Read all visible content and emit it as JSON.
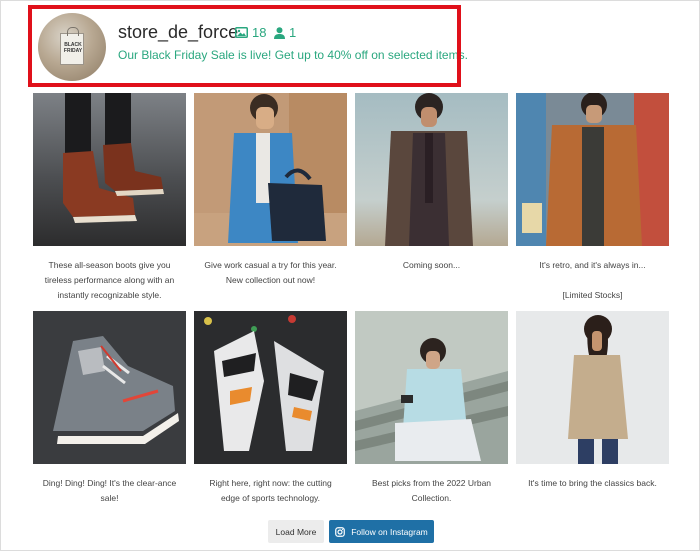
{
  "header": {
    "username": "store_de_force",
    "posts_count": "18",
    "followers_count": "1",
    "bio": "Our Black Friday Sale is live! Get up to 40% off on selected items.",
    "avatar_text": "BLACK FRIDAY"
  },
  "posts": [
    {
      "caption": "These all-season boots give you tireless performance along with an instantly recognizable style."
    },
    {
      "caption": "Give work casual a try for this year. New collection out now!"
    },
    {
      "caption": "Coming soon..."
    },
    {
      "caption": "It's retro, and it's always in...\n\n[Limited Stocks]"
    },
    {
      "caption": "Ding! Ding! Ding! It's the clear-ance sale!"
    },
    {
      "caption": "Right here, right now: the cutting edge of sports technology."
    },
    {
      "caption": "Best picks from the 2022 Urban Collection."
    },
    {
      "caption": "It's time to bring the classics back."
    }
  ],
  "buttons": {
    "load_more": "Load More",
    "follow": "Follow on Instagram"
  },
  "colors": {
    "highlight": "#e0101a",
    "accent_green": "#2aa77f",
    "follow_button": "#1f70a6"
  },
  "icons": {
    "posts": "image-icon",
    "followers": "user-icon",
    "follow": "instagram-icon"
  }
}
